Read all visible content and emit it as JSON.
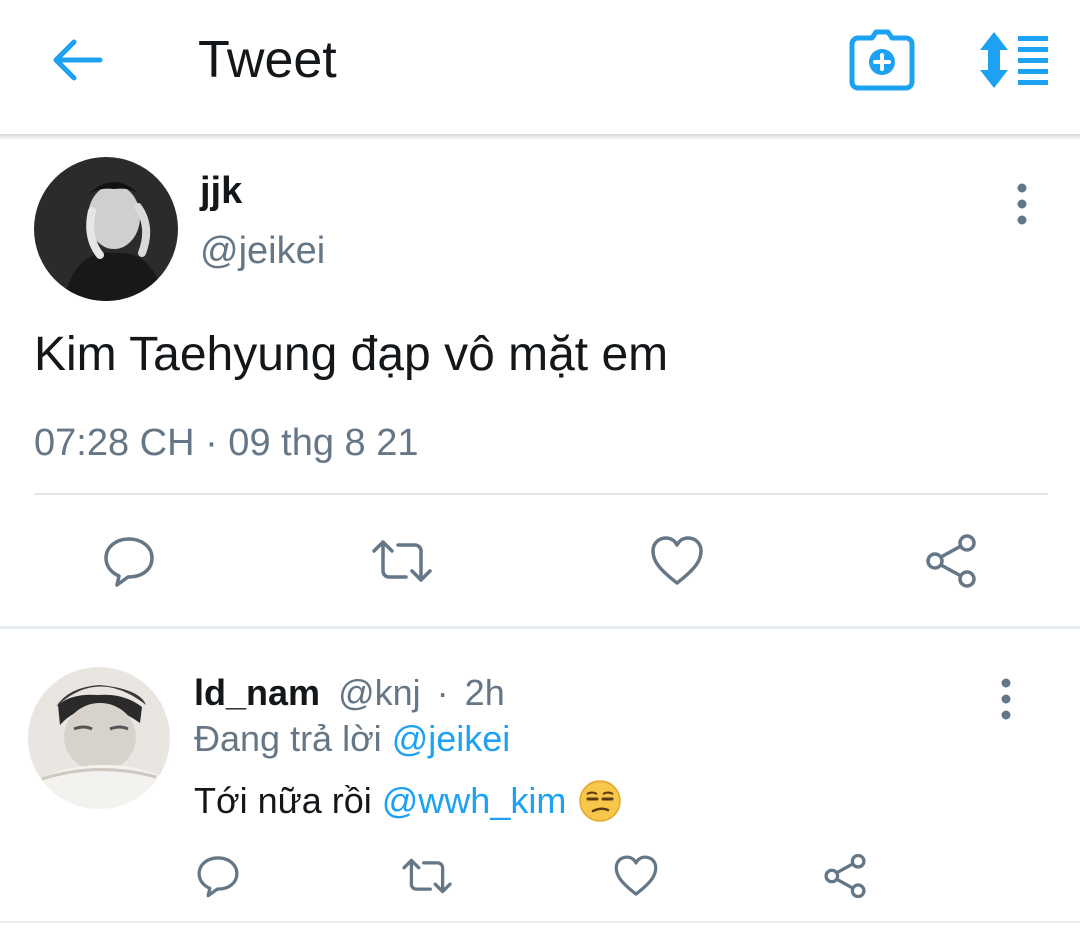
{
  "header": {
    "title": "Tweet",
    "accent_color": "#1da1f2",
    "icons": [
      "back-arrow-icon",
      "camera-plus-icon",
      "sort-icon"
    ]
  },
  "tweet": {
    "display_name": "jjk",
    "handle": "@jeikei",
    "text": "Kim Taehyung đạp vô mặt em",
    "timestamp": "07:28 CH · 09 thg 8 21",
    "actions": [
      "reply-icon",
      "retweet-icon",
      "like-icon",
      "share-icon"
    ]
  },
  "reply": {
    "display_name": "ld_nam",
    "handle": "@knj",
    "separator": "·",
    "age": "2h",
    "replying_prefix": "Đang trả lời",
    "replying_to": "@jeikei",
    "text_prefix": "Tới nữa rồi",
    "mention": "@wwh_kim",
    "emoji": "unamused-face",
    "actions": [
      "reply-icon",
      "retweet-icon",
      "like-icon",
      "share-icon"
    ]
  },
  "colors": {
    "primary_text": "#14171a",
    "secondary_text": "#657786",
    "link": "#1da1f2",
    "divider": "#e6ecf0"
  }
}
